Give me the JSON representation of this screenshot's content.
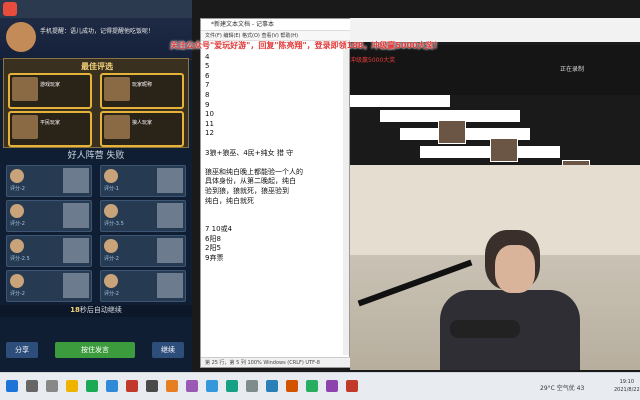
{
  "game": {
    "banner_message": "手机提醒：语儿成功，记得提醒他吃饭呢！",
    "best_title": "最佳评选",
    "best_cards": [
      {
        "name": "游戏玩家"
      },
      {
        "name": "玩家昵称"
      },
      {
        "name": "平民玩家"
      },
      {
        "name": "狼人玩家"
      }
    ],
    "team_title": "好人阵营  失败",
    "players": [
      {
        "score": "评分-2"
      },
      {
        "score": "评分-1"
      },
      {
        "score": "评分-2"
      },
      {
        "score": "评分-3.5"
      },
      {
        "score": "评分-2.5"
      },
      {
        "score": "评分-2"
      },
      {
        "score": "评分-2"
      },
      {
        "score": "评分-2"
      }
    ],
    "continue_hint_num": "18",
    "continue_hint_text": "秒后自动继续",
    "share_label": "分享",
    "speak_label": "按住发言",
    "continue_label": "继续"
  },
  "notepad": {
    "title": "*新建文本文档 - 记事本",
    "menu": "文件(F)  编辑(E)  格式(O)  查看(V)  帮助(H)",
    "text": "3\n4\n5\n6\n7\n8\n9\n10\n11\n12\n\n3狼+狼巫、4民+纯女 猎 守\n\n狼巫和纯白晚上都能验一个人的\n具体身份，从第二晚起，纯白\n验到狼，狼就死，狼巫验到\n纯白，纯白就死\n\n\n7 10或4\n6阳8\n2阳5\n9弃票",
    "status": "第 25 行，第 5 列    100%    Windows (CRLF)    UTF-8"
  },
  "overlay": {
    "notice": "关注公众号\"爱玩好游\"，回复\"陈亮翔\"，登录即领188，冲级赢5000大奖！",
    "sub_notice": "冲级赢5000大奖",
    "panel_label": "正在录制"
  },
  "taskbar": {
    "weather": "29°C 空气优 43",
    "time": "19:10",
    "date": "2021/8/22"
  },
  "colors": {
    "accent_gold": "#e6b33a",
    "notice_red": "#e23a3a",
    "speak_green": "#3c9b3c"
  }
}
